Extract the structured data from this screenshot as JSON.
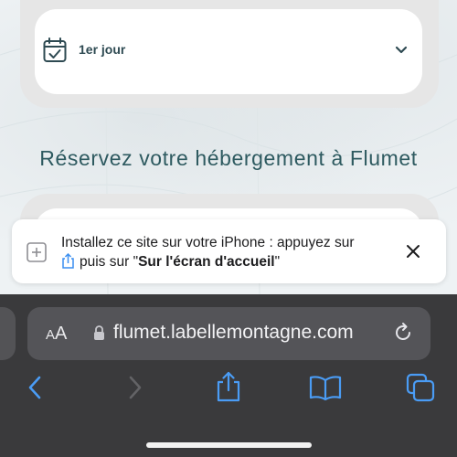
{
  "day_selector": {
    "label": "1er jour",
    "icon": "calendar-check-icon",
    "toggle_icon": "chevron-down-icon"
  },
  "section": {
    "title": "Réservez votre hébergement à Flumet"
  },
  "install_banner": {
    "line1": "Installez ce site sur votre iPhone : appuyez sur",
    "line2_prefix": "puis sur \"",
    "line2_bold": "Sur l'écran d'accueil",
    "line2_suffix": "\"",
    "add_icon": "add-square-icon",
    "share_icon": "share-icon",
    "close_icon": "close-icon"
  },
  "browser": {
    "text_size_label_small": "A",
    "text_size_label_large": "A",
    "url": "flumet.labellemontagne.com",
    "lock_icon": "lock-icon",
    "reload_icon": "reload-icon",
    "toolbar": [
      "back-icon",
      "forward-icon",
      "share-icon",
      "bookmarks-icon",
      "tabs-icon"
    ]
  },
  "colors": {
    "accent": "#2e5a60",
    "browser_blue": "#4a9cf5",
    "browser_bar": "#3a3a3c"
  }
}
